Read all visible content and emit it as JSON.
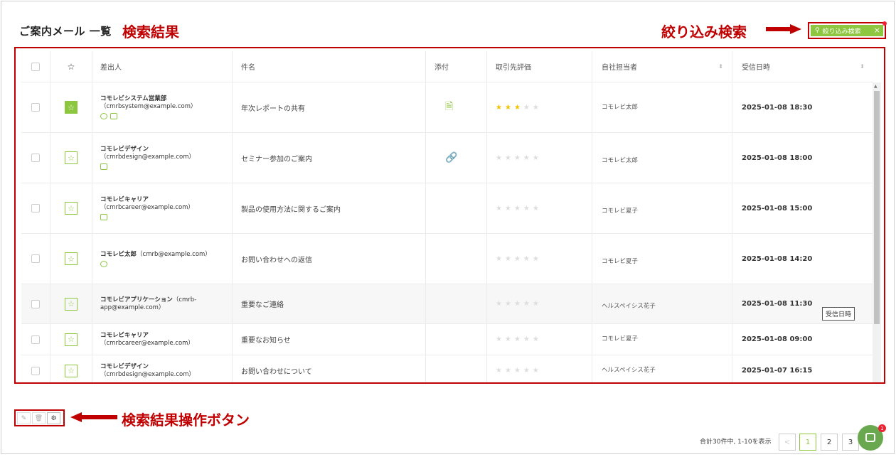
{
  "page": {
    "title": "ご案内メール 一覧",
    "annot_results": "検索結果",
    "annot_filter": "絞り込み検索",
    "annot_ops": "検索結果操作ボタン"
  },
  "filter": {
    "label": "絞り込み検索",
    "close": "×",
    "icon": "search-icon"
  },
  "table": {
    "headers": [
      "差出人",
      "件名",
      "添付",
      "取引先評価",
      "自社担当者",
      "受信日時"
    ],
    "rows": [
      {
        "sender_name": "コモレビシステム営業部",
        "sender_email": "（cmrbsystem@example.com）",
        "subject": "年次レポートの共有",
        "attachment": "document-icon",
        "rating": 3,
        "owner": "コモレビ太郎",
        "date": "2025-01-08 18:30",
        "starred": true
      },
      {
        "sender_name": "コモレビデザイン",
        "sender_email": "（cmrbdesign@example.com）",
        "subject": "セミナー参加のご案内",
        "attachment": "link-icon",
        "rating": 0,
        "owner": "コモレビ太郎",
        "date": "2025-01-08 18:00",
        "starred": false
      },
      {
        "sender_name": "コモレビキャリア",
        "sender_email": "（cmrbcareer@example.com）",
        "subject": "製品の使用方法に関するご案内",
        "attachment": "",
        "rating": 0,
        "owner": "コモレビ夏子",
        "date": "2025-01-08 15:00",
        "starred": false
      },
      {
        "sender_name": "コモレビ太郎",
        "sender_email": "（cmrb@example.com）",
        "subject": "お問い合わせへの返信",
        "attachment": "",
        "rating": 0,
        "owner": "コモレビ夏子",
        "date": "2025-01-08 14:20",
        "starred": false
      },
      {
        "sender_name": "コモレビアプリケーション",
        "sender_email": "（cmrb-app@example.com）",
        "subject": "重要なご連絡",
        "attachment": "",
        "rating": 0,
        "owner": "ヘルスペイシス花子",
        "date": "2025-01-08 11:30",
        "starred": false
      },
      {
        "sender_name": "コモレビキャリア",
        "sender_email": "（cmrbcareer@example.com）",
        "subject": "重要なお知らせ",
        "attachment": "",
        "rating": 0,
        "owner": "コモレビ夏子",
        "date": "2025-01-08 09:00",
        "starred": false
      },
      {
        "sender_name": "コモレビデザイン",
        "sender_email": "（cmrbdesign@example.com）",
        "subject": "お問い合わせについて",
        "attachment": "",
        "rating": 0,
        "owner": "ヘルスペイシス花子",
        "date": "2025-01-07 16:15",
        "starred": false
      }
    ],
    "tooltip": "受信日時"
  },
  "pager": {
    "summary": "合計30件中, 1-10を表示",
    "pages": [
      "1",
      "2",
      "3"
    ],
    "prev": "<"
  },
  "chat": {
    "badge": "1"
  }
}
